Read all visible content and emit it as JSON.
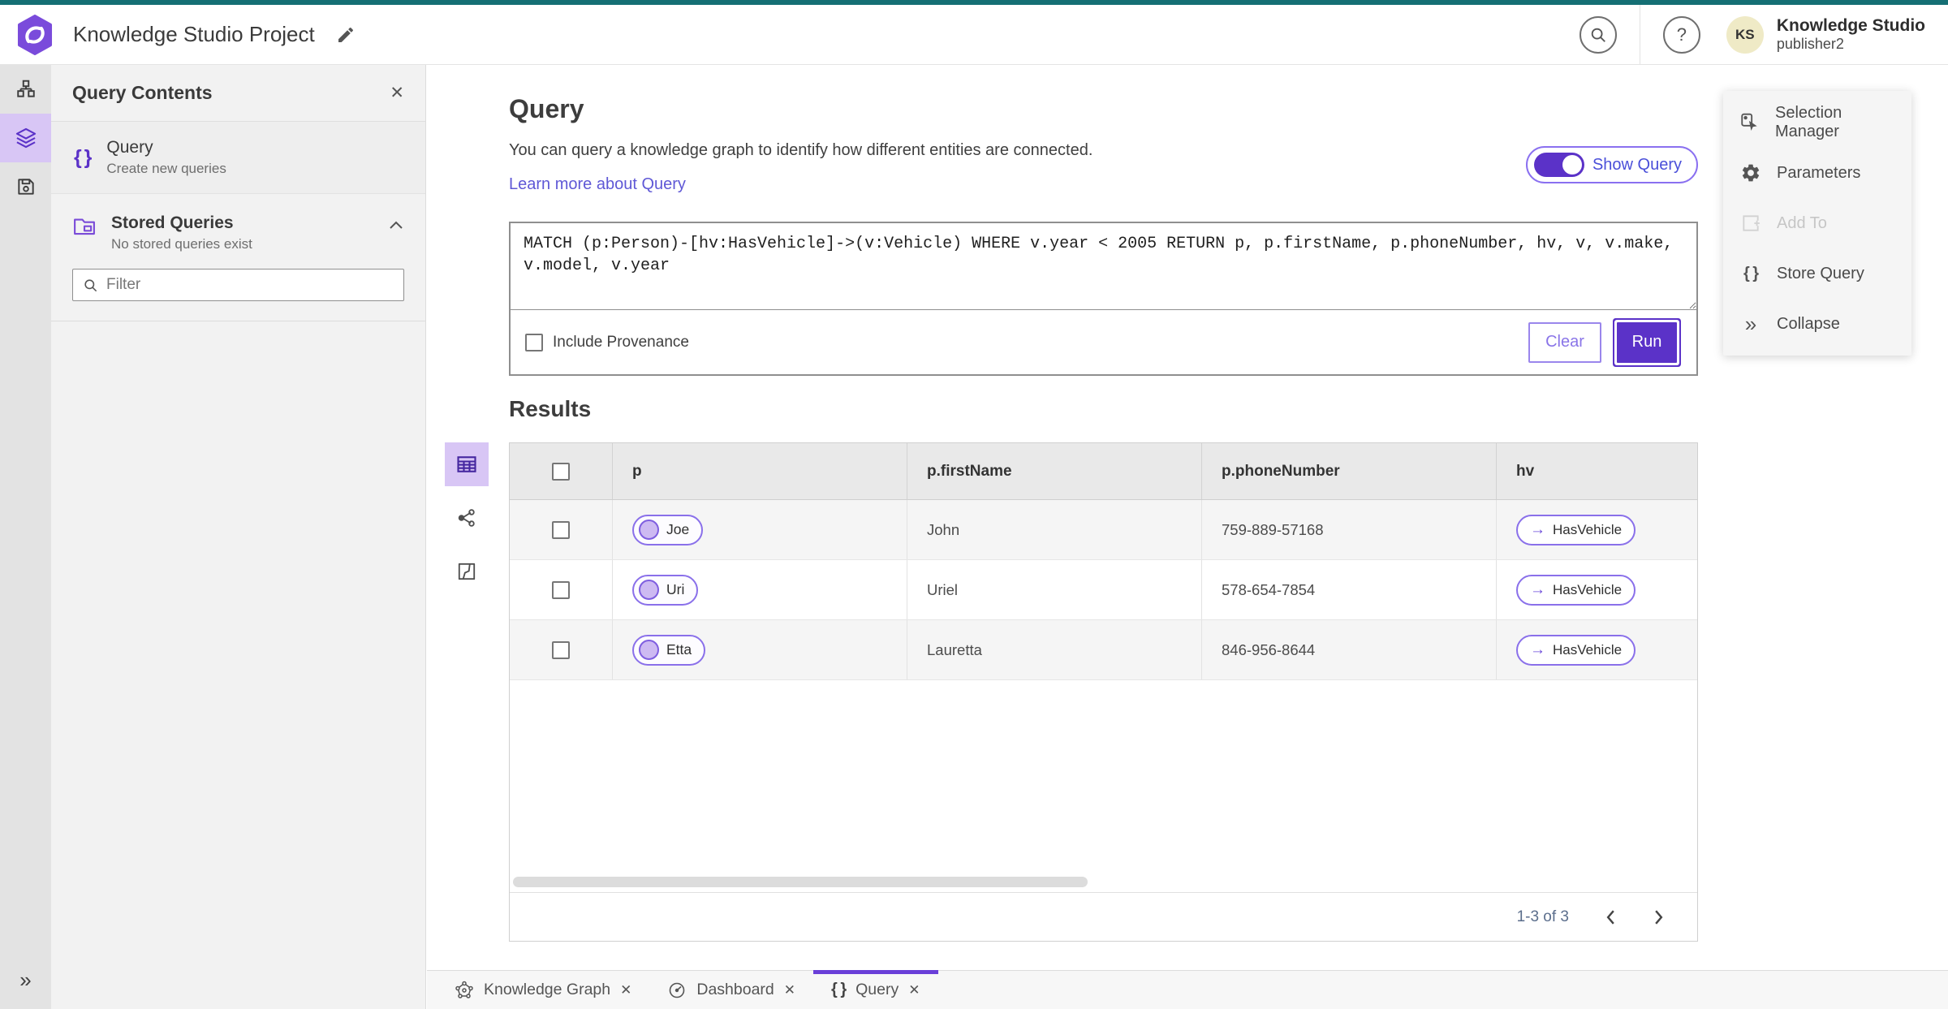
{
  "app": {
    "title": "Knowledge Studio Project",
    "product_name": "Knowledge Studio",
    "user_name": "publisher2",
    "avatar_initials": "KS"
  },
  "colors": {
    "accent_purple": "#5b32c8",
    "top_strip_teal": "#156f74",
    "link_purple": "#5f58d6",
    "selected_light_purple": "#d8c6f5",
    "avatar_yellow": "#efeac6"
  },
  "icons": {
    "close": "✕",
    "help": "?",
    "braces": "{ }",
    "arrow_right": "→",
    "collapse": "»",
    "expand": "»"
  },
  "sidebar": {
    "title": "Query Contents",
    "query_item": {
      "title": "Query",
      "subtitle": "Create new queries"
    },
    "stored_item": {
      "title": "Stored Queries",
      "subtitle": "No stored queries exist"
    },
    "filter_placeholder": "Filter"
  },
  "query_panel": {
    "title": "Query",
    "description": "You can query a knowledge graph to identify how different entities are connected.",
    "learn_link": "Learn more about Query",
    "show_query_label": "Show Query",
    "query_text": "MATCH (p:Person)-[hv:HasVehicle]->(v:Vehicle) WHERE v.year < 2005 RETURN p, p.firstName, p.phoneNumber, hv, v, v.make, v.model, v.year",
    "include_provenance_label": "Include Provenance",
    "clear_label": "Clear",
    "run_label": "Run"
  },
  "results": {
    "title": "Results",
    "columns": [
      "p",
      "p.firstName",
      "p.phoneNumber",
      "hv"
    ],
    "rows": [
      {
        "p_label": "Joe",
        "first_name": "John",
        "phone": "759-889-57168",
        "hv_label": "HasVehicle"
      },
      {
        "p_label": "Uri",
        "first_name": "Uriel",
        "phone": "578-654-7854",
        "hv_label": "HasVehicle"
      },
      {
        "p_label": "Etta",
        "first_name": "Lauretta",
        "phone": "846-956-8644",
        "hv_label": "HasVehicle"
      }
    ],
    "pagination_label": "1-3 of 3"
  },
  "right_panel": {
    "items": [
      "Selection Manager",
      "Parameters",
      "Add To",
      "Store Query",
      "Collapse"
    ]
  },
  "tabs": [
    {
      "label": "Knowledge Graph"
    },
    {
      "label": "Dashboard"
    },
    {
      "label": "Query"
    }
  ]
}
